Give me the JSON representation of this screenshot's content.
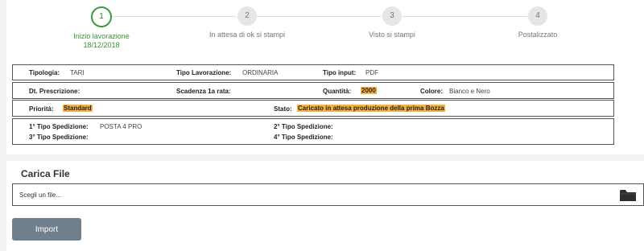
{
  "stepper": {
    "steps": [
      {
        "number": "1",
        "label": "Inizio lavorazione",
        "date": "18/12/2018"
      },
      {
        "number": "2",
        "label": "In attesa di ok si stampi"
      },
      {
        "number": "3",
        "label": "Visto si stampi"
      },
      {
        "number": "4",
        "label": "Postalizzato"
      }
    ]
  },
  "info": {
    "row1": {
      "tipologia_label": "Tipologia:",
      "tipologia_value": "TARI",
      "tipo_lavorazione_label": "Tipo Lavorazione:",
      "tipo_lavorazione_value": "ORDINARIA",
      "tipo_input_label": "Tipo input:",
      "tipo_input_value": "PDF"
    },
    "row2": {
      "dt_prescrizione_label": "Dt. Prescrizione:",
      "dt_prescrizione_value": "",
      "scadenza_label": "Scadenza 1a rata:",
      "scadenza_value": "",
      "quantita_label": "Quantità:",
      "quantita_value": "2000",
      "colore_label": "Colore:",
      "colore_value": "Bianco e Nero"
    },
    "row3": {
      "priorita_label": "Priorità:",
      "priorita_value": "Standard",
      "stato_label": "Stato:",
      "stato_value": "Caricato in attesa produzione della prima Bozza"
    },
    "row4": {
      "sped1_label": "1° Tipo Spedizione:",
      "sped1_value": "POSTA 4 PRO",
      "sped2_label": "2° Tipo Spedizione:",
      "sped2_value": "",
      "sped3_label": "3° Tipo Spedizione:",
      "sped3_value": "",
      "sped4_label": "4° Tipo Spedizione:",
      "sped4_value": ""
    }
  },
  "upload": {
    "title": "Carica File",
    "placeholder": "Scegli un file...",
    "icon": "folder-icon",
    "import_label": "Import"
  },
  "colors": {
    "active_step": "#3a9a3a",
    "highlight": "#f6b23d",
    "button": "#6f7f8c"
  }
}
